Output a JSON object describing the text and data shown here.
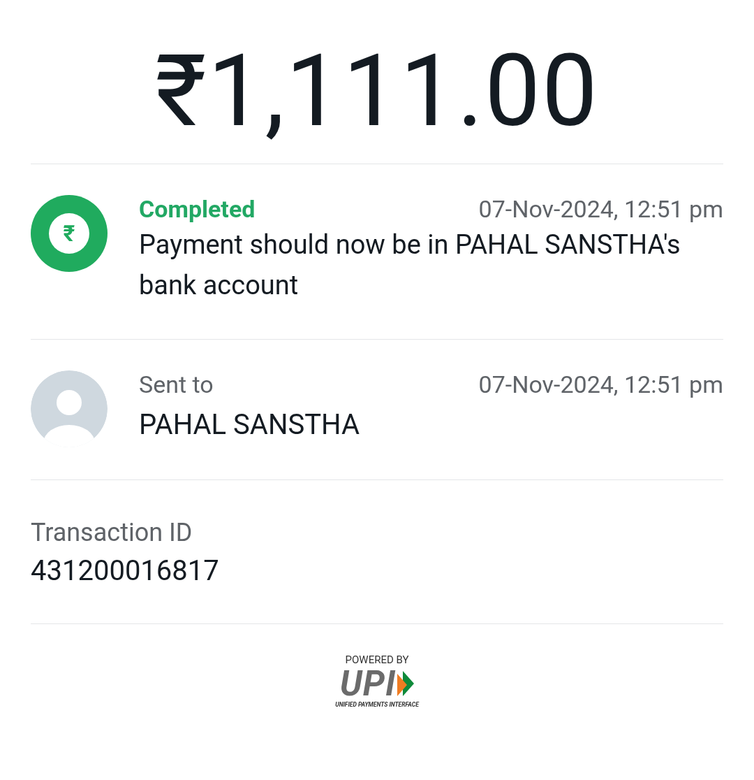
{
  "amount": "₹1,111.00",
  "status": {
    "icon": "₹",
    "label": "Completed",
    "time": "07-Nov-2024, 12:51 pm",
    "message": "Payment should now be in PAHAL SANSTHA's bank account"
  },
  "recipient": {
    "label": "Sent to",
    "time": "07-Nov-2024, 12:51 pm",
    "name": "PAHAL SANSTHA"
  },
  "transaction": {
    "label": "Transaction ID",
    "value": "431200016817"
  },
  "footer": {
    "powered_by": "POWERED BY",
    "logo": "UPI",
    "tagline": "UNIFIED PAYMENTS INTERFACE"
  }
}
